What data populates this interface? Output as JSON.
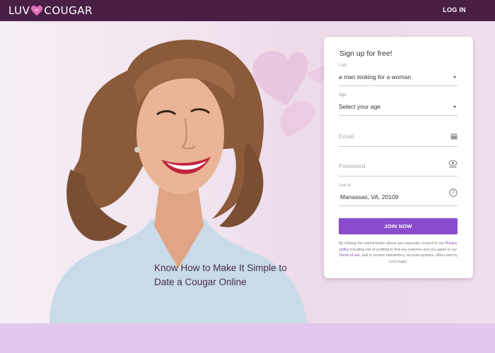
{
  "header": {
    "logo_left": "LUV",
    "logo_right": "COUGAR",
    "login_label": "LOG IN"
  },
  "hero": {
    "headline_line1": "Know How to Make It Simple to",
    "headline_line2": "Date a Cougar Online"
  },
  "signup": {
    "title": "Sign up for free!",
    "iam_label": "I am",
    "iam_value": "a man looking for a woman",
    "age_label": "Age",
    "age_value": "Select your age",
    "email_placeholder": "Email",
    "password_placeholder": "Password",
    "location_label": "Live in",
    "location_value": "Manassas, VA, 20109",
    "join_label": "JOIN NOW",
    "legal_part1": "By clicking the submit button above you expressly consent to our",
    "legal_privacy": "Privacy policy",
    "legal_part2": "including use of profiling to find you matches and you agree to our",
    "legal_terms": "Terms of use",
    "legal_part3": ", and to receive newsletters, account updates, offers sent by LuvCougar."
  },
  "colors": {
    "topbar": "#4a1f46",
    "accent": "#8a4ccc",
    "logo_heart": "#e06fb8",
    "bottom_band": "#e3c7ee"
  },
  "icons": {
    "logo": "heart-icon",
    "email_field": "email-icon",
    "password_field": "eye-icon",
    "location_field": "help-icon"
  }
}
